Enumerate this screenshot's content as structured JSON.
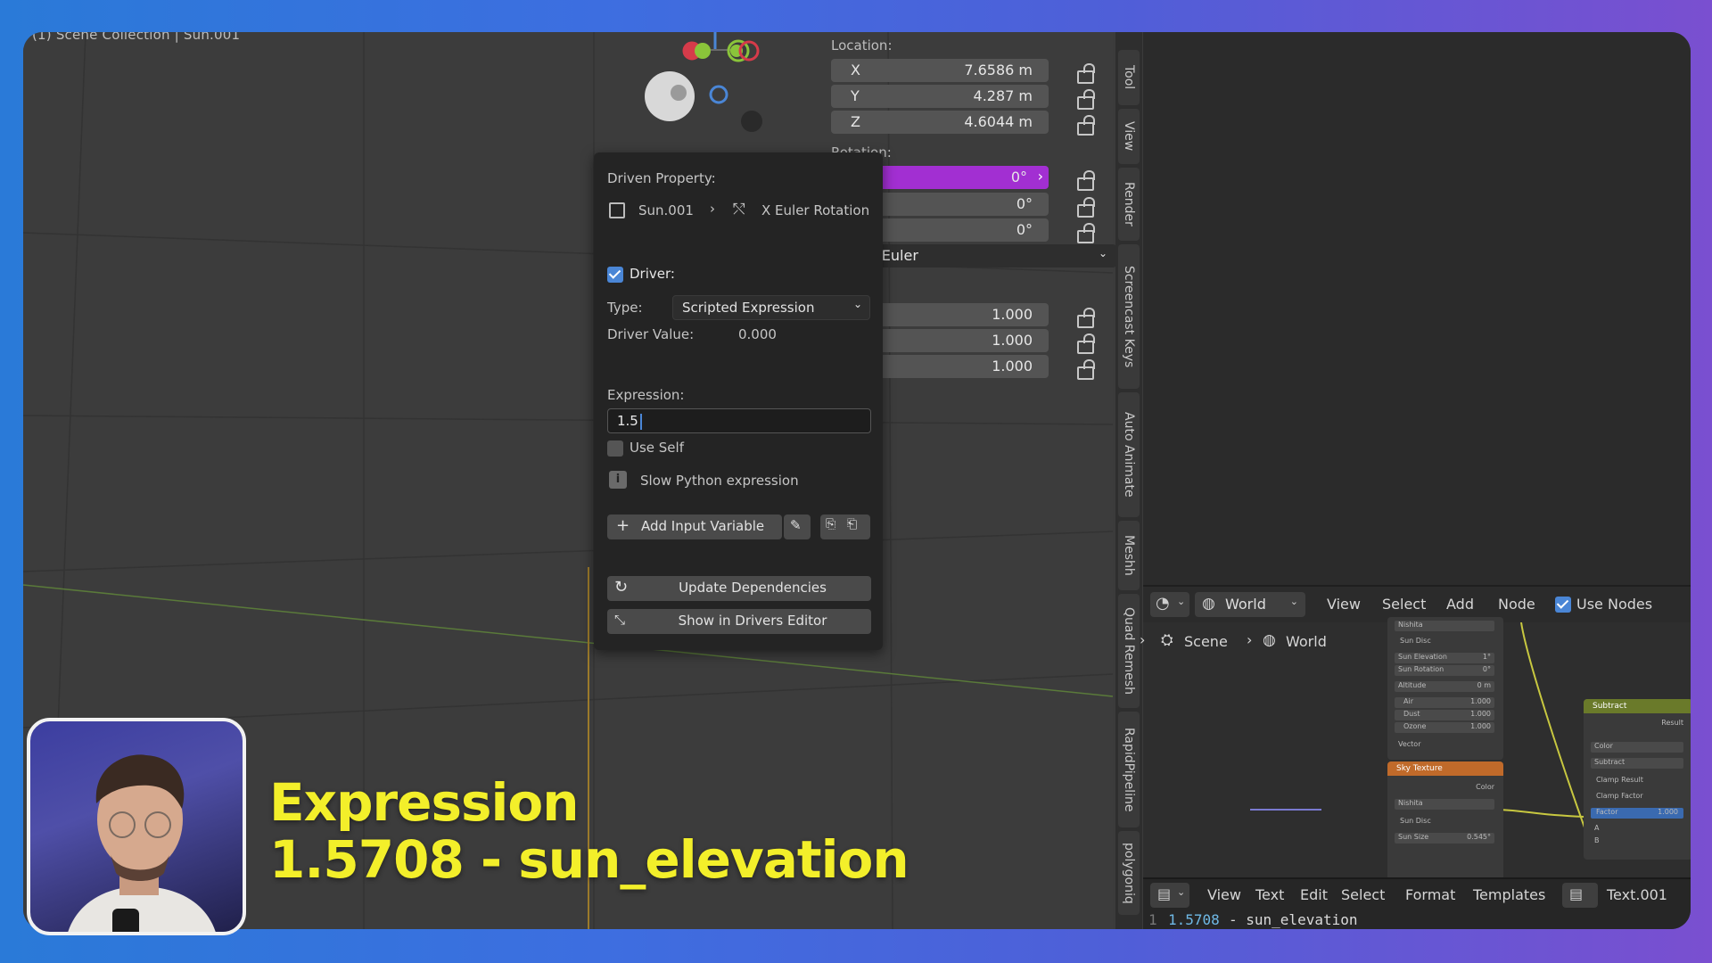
{
  "viewport": {
    "title": "(1) Scene Collection | Sun.001"
  },
  "n_panel": {
    "location_label": "Location:",
    "location": [
      {
        "axis": "X",
        "value": "7.6586 m"
      },
      {
        "axis": "Y",
        "value": "4.287 m"
      },
      {
        "axis": "Z",
        "value": "4.6044 m"
      }
    ],
    "rotation_label": "Rotation:",
    "rotation": [
      {
        "value": "0°"
      },
      {
        "value": "0°"
      },
      {
        "value": "0°"
      }
    ],
    "mode_value": "XYZ Euler",
    "scale": [
      {
        "value": "1.000"
      },
      {
        "value": "1.000"
      },
      {
        "value": "1.000"
      }
    ]
  },
  "side_tabs": [
    "Tool",
    "View",
    "Render",
    "Screencast Keys",
    "Auto Animate",
    "Meshh",
    "Quad Remesh",
    "RapidPipeline",
    "polygoniq"
  ],
  "popup": {
    "driven_property_label": "Driven Property:",
    "object_name": "Sun.001",
    "property_name": "X Euler Rotation",
    "driver_label": "Driver:",
    "type_label": "Type:",
    "type_value": "Scripted Expression",
    "driver_value_label": "Driver Value:",
    "driver_value": "0.000",
    "expression_label": "Expression:",
    "expression_value": "1.5",
    "use_self_label": "Use Self",
    "slow_warning": "Slow Python expression",
    "add_input_variable": "Add Input Variable",
    "update_dependencies": "Update Dependencies",
    "show_in_drivers_editor": "Show in Drivers Editor"
  },
  "node_editor": {
    "world_dropdown": "World",
    "menu": [
      "View",
      "Select",
      "Add",
      "Node"
    ],
    "use_nodes_label": "Use Nodes",
    "breadcrumb": [
      "Scene",
      "World"
    ],
    "sky_node": {
      "title": "Sky Texture",
      "rows": [
        "Nishita",
        "Sun Disc",
        "Sun Elevation",
        "Sun Rotation",
        "Altitude",
        "Air",
        "Dust",
        "Ozone"
      ],
      "values": [
        "",
        "",
        "1°",
        "0°",
        "0 m",
        "1.000",
        "1.000",
        "1.000"
      ],
      "output": "Color",
      "vector": "Vector"
    },
    "sky_node2": {
      "title": "Sky Texture",
      "rows": [
        "Nishita",
        "Sun Disc",
        "Sun Size"
      ],
      "values": [
        "",
        "",
        "0.545°"
      ]
    },
    "subtract_node": {
      "title": "Subtract",
      "output": "Result",
      "rows": [
        "Color",
        "Subtract",
        "Clamp Result",
        "Clamp Factor"
      ],
      "factor_label": "Factor",
      "factor_value": "1.000",
      "inputs": [
        "A",
        "B"
      ]
    }
  },
  "text_editor": {
    "menu": [
      "View",
      "Text",
      "Edit",
      "Select",
      "Format",
      "Templates"
    ],
    "file": "Text.001",
    "line_number": "1",
    "line_value": "1.5708",
    "line_rest": "- sun_elevation"
  },
  "caption": {
    "line1": "Expression",
    "line2": "1.5708 - sun_elevation"
  },
  "colors": {
    "accent": "#a22fd2",
    "checkbox": "#4a86d6",
    "caption": "#f3ef2a"
  }
}
